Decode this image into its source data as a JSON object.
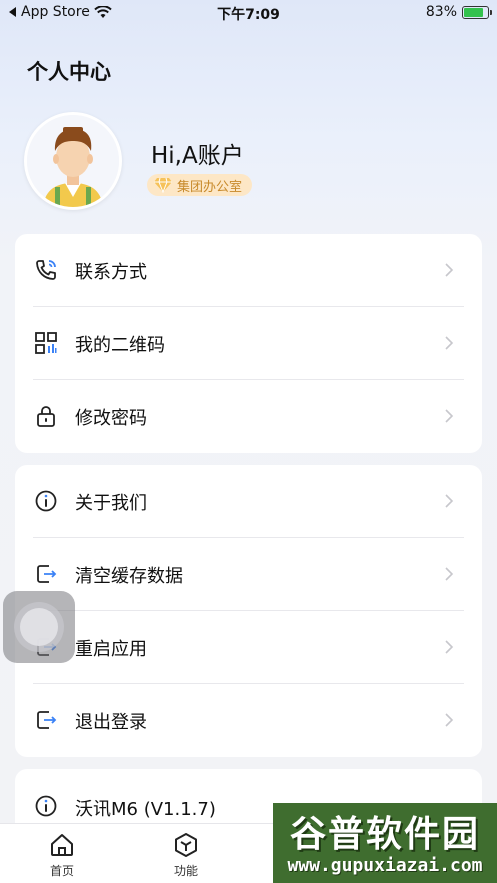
{
  "status_bar": {
    "back_app": "App Store",
    "time": "下午7:09",
    "battery": "83%",
    "battery_level": 0.83
  },
  "header": {
    "title": "个人中心"
  },
  "profile": {
    "greeting": "Hi,A账户",
    "role": "集团办公室"
  },
  "menu_group_1": {
    "items": [
      {
        "label": "联系方式",
        "icon": "phone-icon"
      },
      {
        "label": "我的二维码",
        "icon": "qrcode-icon"
      },
      {
        "label": "修改密码",
        "icon": "lock-icon"
      }
    ]
  },
  "menu_group_2": {
    "items": [
      {
        "label": "关于我们",
        "icon": "info-icon"
      },
      {
        "label": "清空缓存数据",
        "icon": "exit-icon"
      },
      {
        "label": "重启应用",
        "icon": "exit-icon"
      },
      {
        "label": "退出登录",
        "icon": "exit-icon"
      }
    ]
  },
  "menu_group_3": {
    "items": [
      {
        "label": "沃讯M6 (V1.1.7)",
        "icon": "info-icon"
      }
    ]
  },
  "tabbar": {
    "tabs": [
      {
        "label": "首页",
        "icon": "home-icon"
      },
      {
        "label": "功能",
        "icon": "cube-icon"
      }
    ]
  },
  "watermark": {
    "text": "谷普软件园",
    "url": "www.gupuxiazai.com"
  },
  "colors": {
    "accent": "#222222",
    "badge_bg": "#fde7c6",
    "badge_text": "#c88a2b"
  }
}
